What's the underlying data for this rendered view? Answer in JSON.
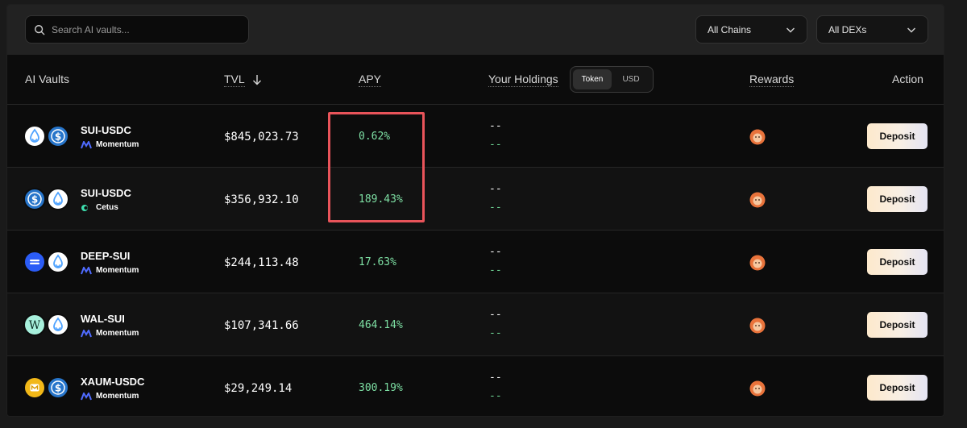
{
  "search": {
    "placeholder": "Search AI vaults..."
  },
  "filters": {
    "chains": "All Chains",
    "dexs": "All DEXs"
  },
  "columns": {
    "vaults": "AI Vaults",
    "tvl": "TVL",
    "apy": "APY",
    "holdings": "Your Holdings",
    "rewards": "Rewards",
    "action": "Action"
  },
  "holdings_toggle": {
    "token": "Token",
    "usd": "USD",
    "selected": "Token"
  },
  "rows": [
    {
      "pair": "SUI-USDC",
      "dex": "Momentum",
      "tvl": "$845,023.73",
      "apy": "0.62%",
      "holding_top": "--",
      "holding_bottom": "--",
      "action": "Deposit",
      "tokens": [
        "sui-icon",
        "usdc-icon"
      ]
    },
    {
      "pair": "SUI-USDC",
      "dex": "Cetus",
      "tvl": "$356,932.10",
      "apy": "189.43%",
      "holding_top": "--",
      "holding_bottom": "--",
      "action": "Deposit",
      "tokens": [
        "usdc-icon",
        "sui-icon"
      ]
    },
    {
      "pair": "DEEP-SUI",
      "dex": "Momentum",
      "tvl": "$244,113.48",
      "apy": "17.63%",
      "holding_top": "--",
      "holding_bottom": "--",
      "action": "Deposit",
      "tokens": [
        "deep-icon",
        "sui-icon"
      ]
    },
    {
      "pair": "WAL-SUI",
      "dex": "Momentum",
      "tvl": "$107,341.66",
      "apy": "464.14%",
      "holding_top": "--",
      "holding_bottom": "--",
      "action": "Deposit",
      "tokens": [
        "wal-icon",
        "sui-icon"
      ]
    },
    {
      "pair": "XAUM-USDC",
      "dex": "Momentum",
      "tvl": "$29,249.14",
      "apy": "300.19%",
      "holding_top": "--",
      "holding_bottom": "--",
      "action": "Deposit",
      "tokens": [
        "xaum-icon",
        "usdc-icon"
      ]
    }
  ],
  "colors": {
    "apy": "#7ee0a4",
    "highlight": "#e9545a",
    "background": "#0c0c0c"
  }
}
